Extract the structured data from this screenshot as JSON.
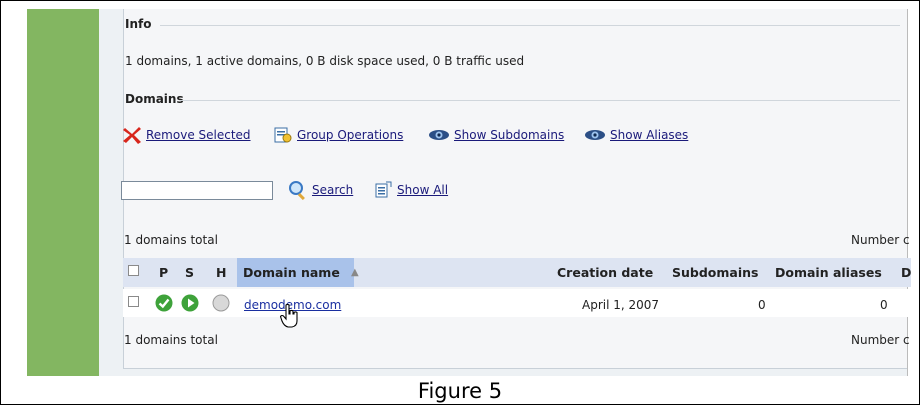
{
  "info": {
    "title": "Info",
    "summary": "1 domains, 1 active domains, 0 B disk space used, 0 B traffic used"
  },
  "domains": {
    "title": "Domains",
    "toolbar": {
      "remove_selected": "Remove Selected",
      "group_operations": "Group Operations",
      "show_subdomains": "Show Subdomains",
      "show_aliases": "Show Aliases"
    },
    "search": {
      "value": "",
      "button": "Search",
      "show_all": "Show All"
    },
    "total_top": "1 domains total",
    "total_bottom": "1 domains total",
    "per_page_top": "Number c",
    "per_page_bottom": "Number c",
    "table": {
      "headers": {
        "p": "P",
        "s": "S",
        "h": "H",
        "domain_name": "Domain name",
        "sort_indicator": "▲",
        "creation_date": "Creation date",
        "subdomains": "Subdomains",
        "domain_aliases": "Domain aliases",
        "d": "D"
      },
      "rows": [
        {
          "domain_name": "demodemo.com",
          "creation_date": "April 1, 2007",
          "subdomains": "0",
          "domain_aliases": "0",
          "p_status": "active",
          "s_status": "running",
          "h_status": "off"
        }
      ]
    }
  },
  "caption": "Figure 5",
  "colors": {
    "sidebar": "#83b661",
    "header_selected": "#a9c2ea",
    "header": "#dde4f2",
    "link": "#1a2fa0"
  }
}
